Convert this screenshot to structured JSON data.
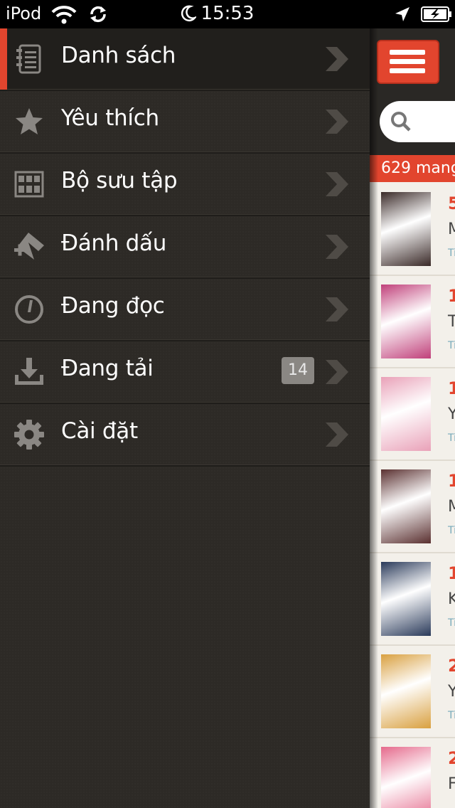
{
  "status_bar": {
    "carrier": "iPod",
    "time": "15:53"
  },
  "menu": {
    "items": [
      {
        "label": "Danh sách",
        "icon": "list-icon",
        "active": true
      },
      {
        "label": "Yêu thích",
        "icon": "star-icon"
      },
      {
        "label": "Bộ sưu tập",
        "icon": "collection-grid-icon"
      },
      {
        "label": "Đánh dấu",
        "icon": "bookmark-icon"
      },
      {
        "label": "Đang đọc",
        "icon": "reading-gauge-icon"
      },
      {
        "label": "Đang tải",
        "icon": "download-icon",
        "badge": "14"
      },
      {
        "label": "Cài đặt",
        "icon": "gear-icon"
      }
    ]
  },
  "main": {
    "count_text": "629 mang",
    "rows": [
      {
        "number": "5",
        "title_initial": "M",
        "sub": "Ti",
        "cover": "#3a2a28"
      },
      {
        "number": "1",
        "title_initial": "T",
        "sub": "Ti",
        "cover": "#c0407a"
      },
      {
        "number": "1",
        "title_initial": "Y",
        "sub": "Ti",
        "cover": "#e9a1b8"
      },
      {
        "number": "1",
        "title_initial": "M",
        "sub": "Ti",
        "cover": "#5a3030"
      },
      {
        "number": "1",
        "title_initial": "K",
        "sub": "Ti",
        "cover": "#2a3a5a"
      },
      {
        "number": "2",
        "title_initial": "Y",
        "sub": "Ti",
        "cover": "#d9a040"
      },
      {
        "number": "2",
        "title_initial": "F",
        "sub": "",
        "cover": "#e56a8c"
      }
    ]
  },
  "colors": {
    "accent": "#e2452e",
    "drawer_bg": "#2d2a26",
    "icon_gray": "#8a8783"
  }
}
